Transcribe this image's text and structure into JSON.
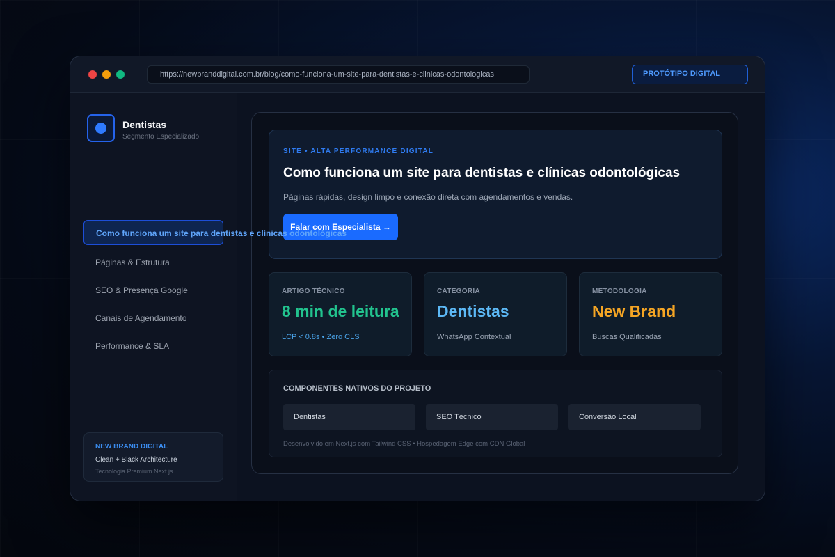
{
  "window": {
    "url": "https://newbranddigital.com.br/blog/como-funciona-um-site-para-dentistas-e-clinicas-odontologicas",
    "badge": "PROTÓTIPO DIGITAL"
  },
  "sidebar": {
    "brand_title": "Dentistas",
    "brand_subtitle": "Segmento Especializado",
    "items": [
      {
        "label": "Como funciona um site para dentistas e clínicas odontológicas",
        "active": true
      },
      {
        "label": "Páginas & Estrutura",
        "active": false
      },
      {
        "label": "SEO & Presença Google",
        "active": false
      },
      {
        "label": "Canais de Agendamento",
        "active": false
      },
      {
        "label": "Performance & SLA",
        "active": false
      }
    ],
    "card": {
      "title": "NEW BRAND DIGITAL",
      "line1": "Clean + Black Architecture",
      "line2": "Tecnologia Premium Next.js"
    }
  },
  "hero": {
    "eyebrow": "SITE • ALTA PERFORMANCE DIGITAL",
    "title": "Como funciona um site para dentistas e clínicas odontológicas",
    "description": "Páginas rápidas, design limpo e conexão direta com agendamentos e vendas.",
    "cta_label": "Falar com Especialista →"
  },
  "stats": [
    {
      "label": "ARTIGO TÉCNICO",
      "value": "8 min de leitura",
      "sub": "LCP < 0.8s • Zero CLS",
      "color": "#22c38e",
      "sub_color": "#4aa3e8"
    },
    {
      "label": "CATEGORIA",
      "value": "Dentistas",
      "sub": "WhatsApp Contextual",
      "color": "#5cb8f5",
      "sub_color": "#9ba5b4"
    },
    {
      "label": "METODOLOGIA",
      "value": "New Brand",
      "sub": "Buscas Qualificadas",
      "color": "#f5a524",
      "sub_color": "#9ba5b4"
    }
  ],
  "components": {
    "title": "COMPONENTES NATIVOS DO PROJETO",
    "chips": [
      "Dentistas",
      "SEO Técnico",
      "Conversão Local"
    ],
    "footer": "Desenvolvido em Next.js com Tailwind CSS • Hospedagem Edge com CDN Global"
  }
}
